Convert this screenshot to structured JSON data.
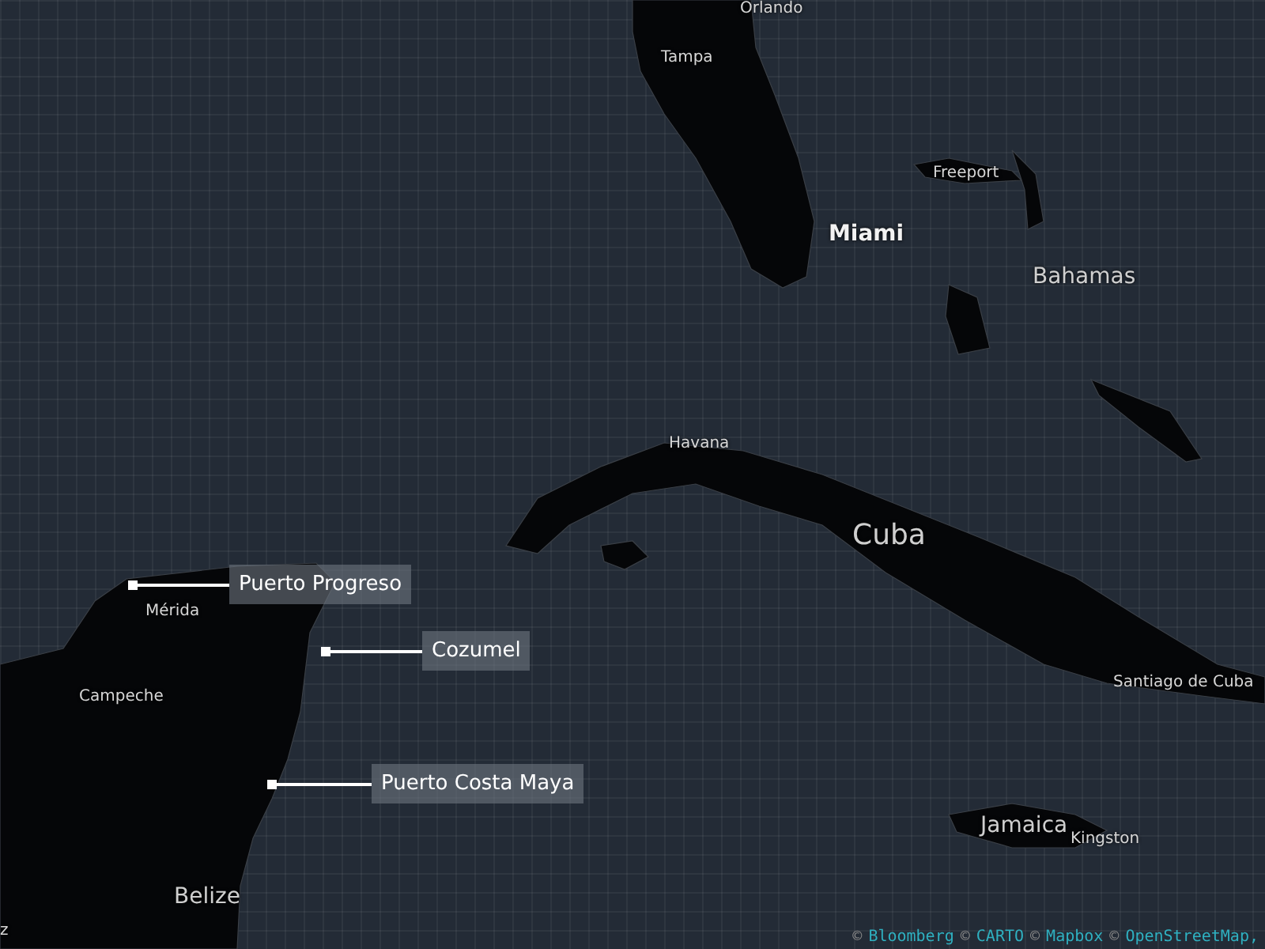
{
  "place_labels": [
    {
      "text": "Orlando",
      "kind": "city"
    },
    {
      "text": "Tampa",
      "kind": "city"
    },
    {
      "text": "Freeport",
      "kind": "city"
    },
    {
      "text": "Miami",
      "kind": "major"
    },
    {
      "text": "Bahamas",
      "kind": "country"
    },
    {
      "text": "Havana",
      "kind": "city"
    },
    {
      "text": "Cuba",
      "kind": "big"
    },
    {
      "text": "Mérida",
      "kind": "city"
    },
    {
      "text": "Campeche",
      "kind": "city"
    },
    {
      "text": "Santiago de Cuba",
      "kind": "city"
    },
    {
      "text": "Jamaica",
      "kind": "country"
    },
    {
      "text": "Kingston",
      "kind": "city"
    },
    {
      "text": "Belize",
      "kind": "country"
    },
    {
      "text": "z",
      "kind": "city"
    }
  ],
  "callouts": [
    {
      "label": "Puerto Progreso"
    },
    {
      "label": "Cozumel"
    },
    {
      "label": "Puerto Costa Maya"
    }
  ],
  "attribution": [
    {
      "mark": "©",
      "text": "Bloomberg"
    },
    {
      "mark": "©",
      "text": "CARTO"
    },
    {
      "mark": "©",
      "text": "Mapbox"
    },
    {
      "mark": "©",
      "text": "OpenStreetMap,"
    }
  ]
}
